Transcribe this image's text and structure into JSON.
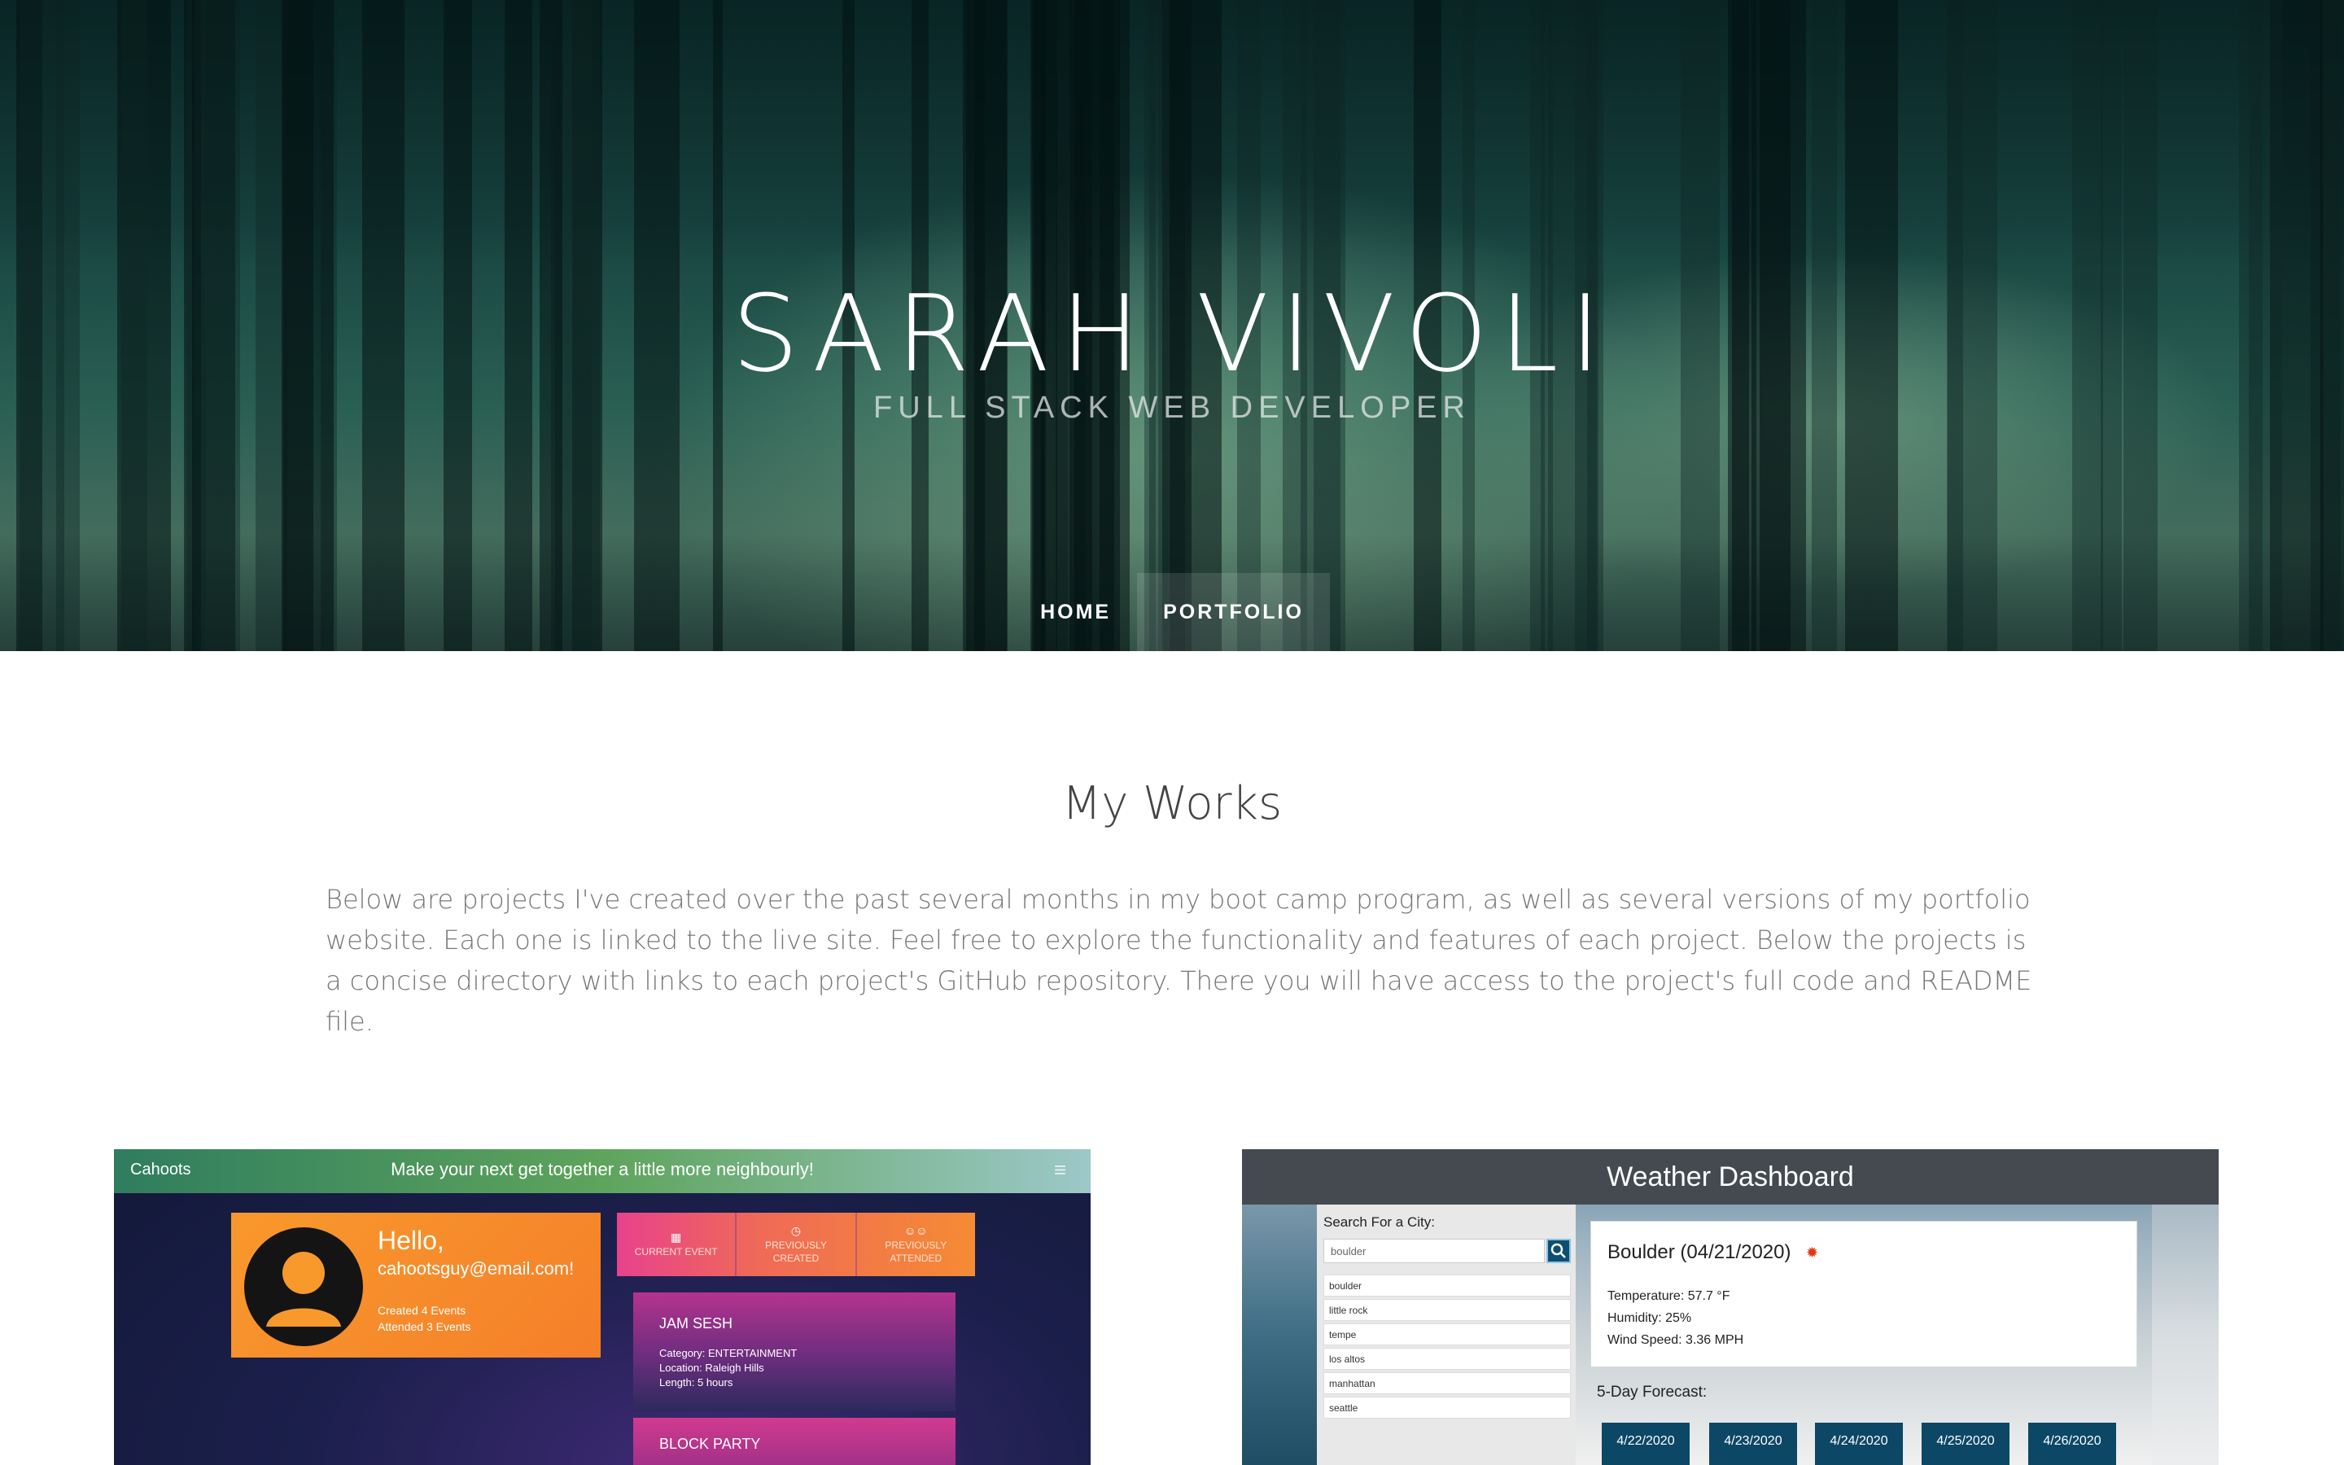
{
  "header": {
    "name": "SARAH VIVOLI",
    "subtitle": "FULL STACK WEB DEVELOPER"
  },
  "nav": {
    "items": [
      {
        "label": "HOME",
        "active": false
      },
      {
        "label": "PORTFOLIO",
        "active": true
      }
    ]
  },
  "main": {
    "title": "My Works",
    "description": "Below are projects I've created over the past several months in my boot camp program, as well as several versions of my portfolio website. Each one is linked to the live site. Feel free to explore the functionality and features of each project. Below the projects is a concise directory with links to each project's GitHub repository. There you will have access to the project's full code and README file."
  },
  "projects": [
    {
      "app": "cahoots",
      "brand": "Cahoots",
      "tagline": "Make your next get together a little more neighbourly!",
      "greeting": "Hello,",
      "email": "cahootsguy@email.com!",
      "stat_created": "Created 4 Events",
      "stat_attended": "Attended 3 Events",
      "tabs": [
        {
          "icon": "calendar-icon",
          "line1": "CURRENT EVENT",
          "line2": ""
        },
        {
          "icon": "history-icon",
          "line1": "PREVIOUSLY",
          "line2": "CREATED"
        },
        {
          "icon": "people-icon",
          "line1": "PREVIOUSLY",
          "line2": "ATTENDED"
        }
      ],
      "events": [
        {
          "title": "JAM SESH",
          "category": "Category: ENTERTAINMENT",
          "location": "Location: Raleigh Hills",
          "length": "Length: 5 hours"
        },
        {
          "title": "BLOCK PARTY"
        }
      ]
    },
    {
      "app": "weather",
      "title": "Weather Dashboard",
      "search_label": "Search For a City:",
      "search_value": "boulder",
      "history": [
        "boulder",
        "little rock",
        "tempe",
        "los altos",
        "manhattan",
        "seattle"
      ],
      "city_header": "Boulder (04/21/2020)",
      "weather_icon": "sun-icon",
      "temperature": "Temperature: 57.7 °F",
      "humidity": "Humidity: 25%",
      "wind": "Wind Speed: 3.36 MPH",
      "forecast_label": "5-Day Forecast:",
      "forecast_days": [
        "4/22/2020",
        "4/23/2020",
        "4/24/2020",
        "4/25/2020",
        "4/26/2020"
      ]
    }
  ],
  "colors": {
    "hero_dark": "#0c2a2a",
    "cahoots_orange": "#f8992c",
    "weather_bar": "#444a50",
    "forecast_blue": "#0c4766"
  }
}
